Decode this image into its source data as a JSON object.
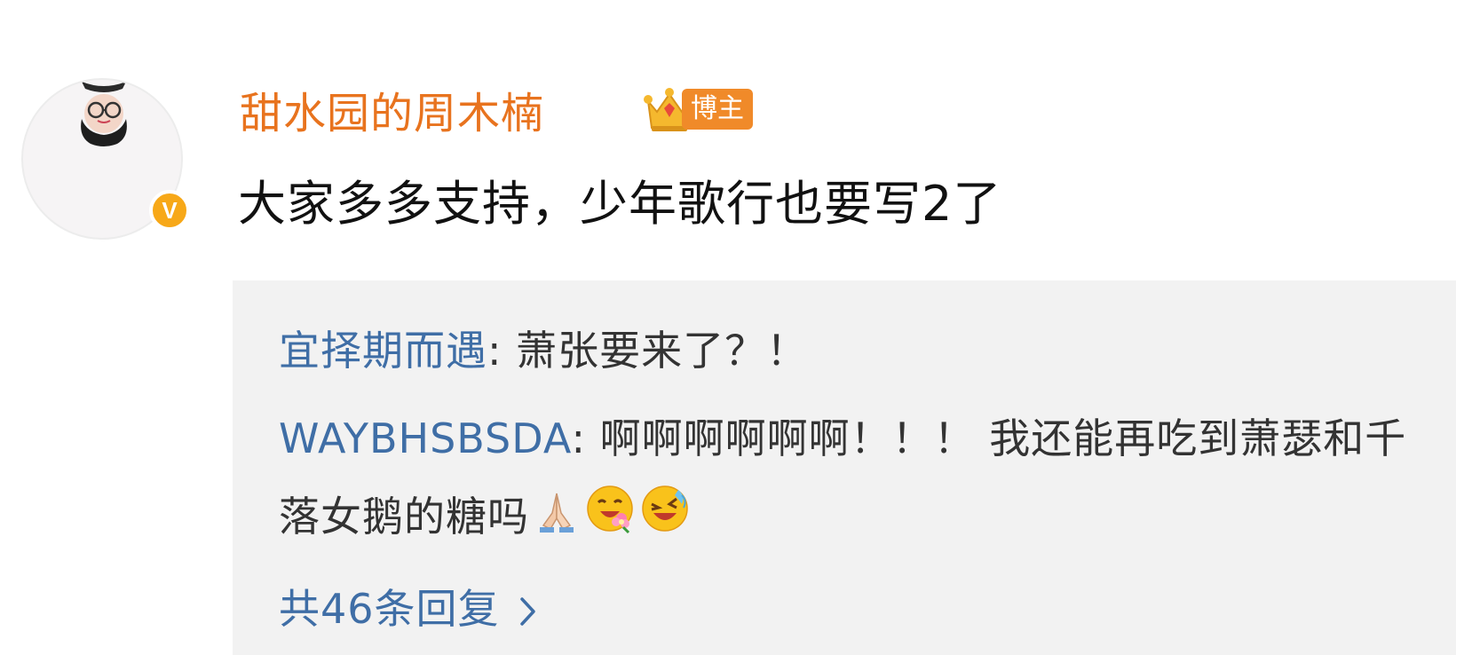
{
  "comment": {
    "author": "甜水园的周木楠",
    "author_tag": "博主",
    "text": "大家多多支持，少年歌行也要写2了"
  },
  "replies": [
    {
      "user": "宜择期而遇",
      "separator": ": ",
      "text": "萧张要来了？！"
    },
    {
      "user": "WAYBHSBSDA",
      "separator": ": ",
      "text": "啊啊啊啊啊啊！！！ 我还能再吃到萧瑟和千落女鹅的糖吗"
    }
  ],
  "more_replies": "共46条回复",
  "icons": {
    "verified": "verified-v-icon",
    "crown": "crown-icon",
    "pray": "pray-emoji",
    "flower": "flower-emoji",
    "laugh": "laugh-emoji",
    "chevron": "chevron-right-icon"
  },
  "colors": {
    "author": "#e8731e",
    "tag_bg": "#f08a29",
    "reply_user": "#3f6ea6",
    "reply_bg": "#f2f2f2",
    "verified": "#f7a818"
  }
}
